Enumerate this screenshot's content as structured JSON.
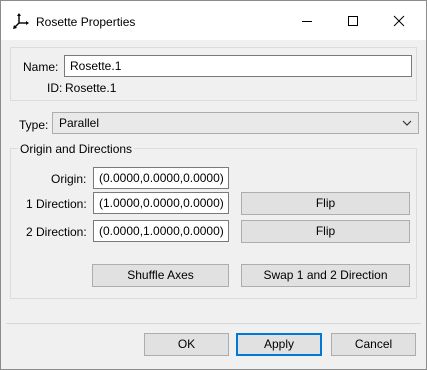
{
  "window": {
    "title": "Rosette Properties"
  },
  "name_group": {
    "name_label": "Name:",
    "name_value": "Rosette.1",
    "id_label": "ID:",
    "id_value": "Rosette.1"
  },
  "type": {
    "label": "Type:",
    "selected": "Parallel"
  },
  "origin_directions": {
    "group_label": "Origin and Directions",
    "origin_label": "Origin:",
    "origin_value": "(0.0000,0.0000,0.0000)",
    "dir1_label": "1 Direction:",
    "dir1_value": "(1.0000,0.0000,0.0000)",
    "dir2_label": "2 Direction:",
    "dir2_value": "(0.0000,1.0000,0.0000)",
    "flip1_label": "Flip",
    "flip2_label": "Flip",
    "shuffle_label": "Shuffle Axes",
    "swap_label": "Swap 1 and 2 Direction"
  },
  "footer": {
    "ok_label": "OK",
    "apply_label": "Apply",
    "cancel_label": "Cancel"
  },
  "icons": {
    "title": "rosette-axes-icon",
    "minimize": "minimize-icon",
    "maximize": "maximize-icon",
    "close": "close-icon",
    "dropdown": "chevron-down-icon"
  }
}
